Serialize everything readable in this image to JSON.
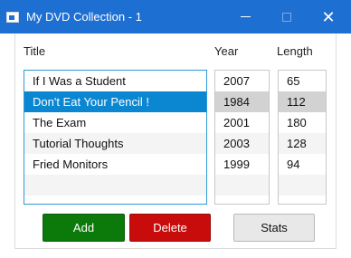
{
  "window": {
    "title": "My DVD Collection - 1"
  },
  "columns": {
    "title": "Title",
    "year": "Year",
    "length": "Length"
  },
  "dvds": [
    {
      "title": "If I Was a Student",
      "year": "2007",
      "length": "65"
    },
    {
      "title": "Don't Eat Your Pencil !",
      "year": "1984",
      "length": "112"
    },
    {
      "title": "The Exam",
      "year": "2001",
      "length": "180"
    },
    {
      "title": "Tutorial Thoughts",
      "year": "2003",
      "length": "128"
    },
    {
      "title": "Fried Monitors",
      "year": "1999",
      "length": "94"
    }
  ],
  "selected_index": 1,
  "buttons": {
    "add": "Add",
    "delete": "Delete",
    "stats": "Stats"
  },
  "colors": {
    "titlebar": "#1e6fd2",
    "selection": "#0b86d1",
    "add": "#0b7a0b",
    "delete": "#c80c0c"
  },
  "icons": {
    "app": "window-app-icon",
    "minimize": "minimize-icon",
    "maximize": "maximize-icon",
    "close": "close-icon"
  }
}
